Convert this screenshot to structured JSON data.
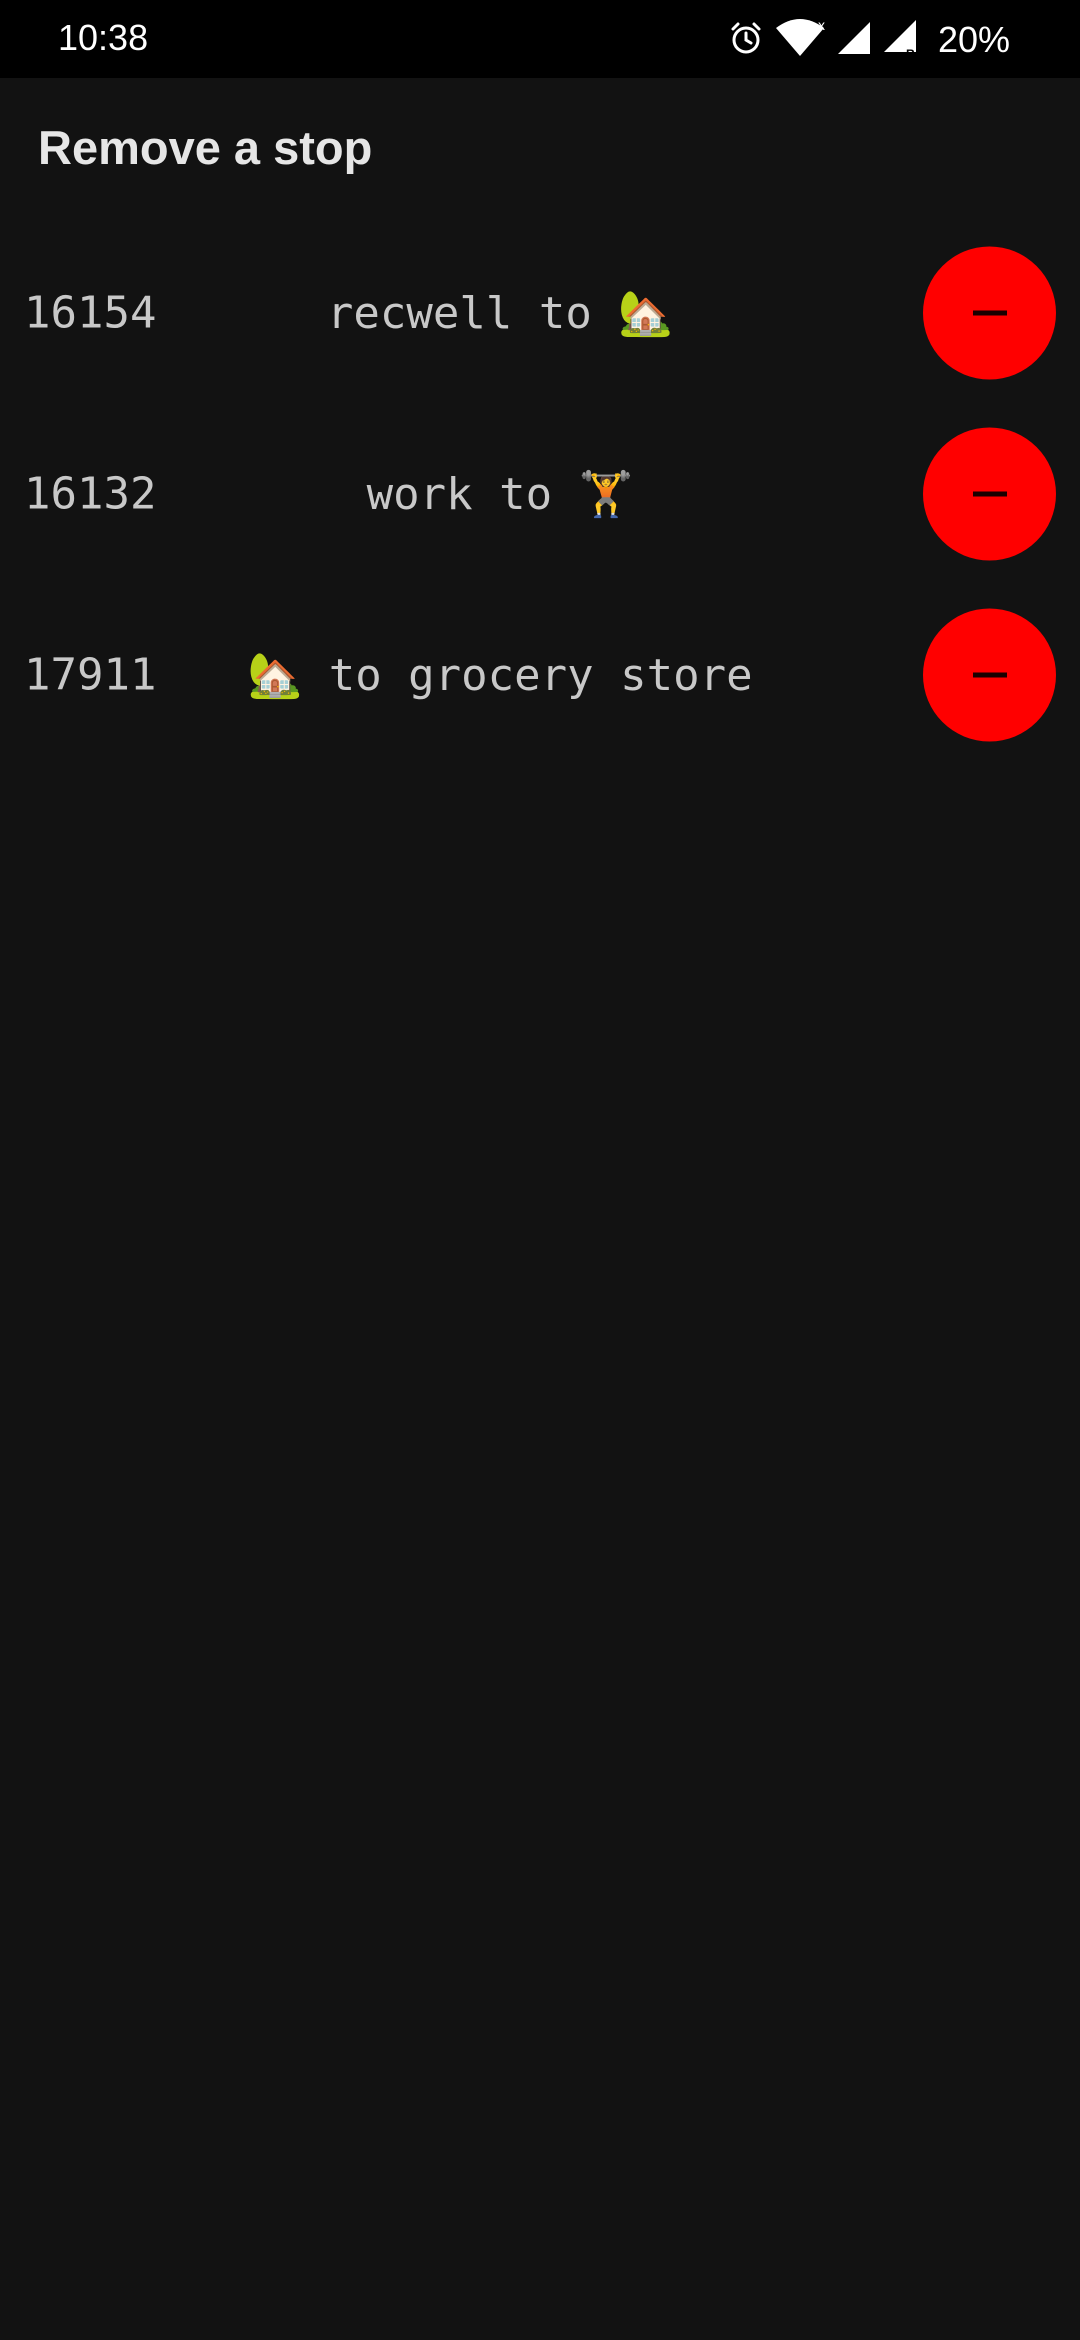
{
  "status_bar": {
    "time": "10:38",
    "battery": "20%",
    "icons": [
      "alarm-icon",
      "wifi-icon",
      "cell-signal-icon",
      "cell-signal-roaming-icon"
    ]
  },
  "header": {
    "title": "Remove a stop"
  },
  "stops": [
    {
      "id": "16154",
      "description": "recwell to 🏡"
    },
    {
      "id": "16132",
      "description": "work to 🏋️"
    },
    {
      "id": "17911",
      "description": "🏡 to grocery store"
    }
  ],
  "colors": {
    "background": "#121212",
    "status_bar": "#000000",
    "remove_button": "#ff0000",
    "text": "#c8c8c8",
    "title": "#e6e6e6"
  },
  "icons": {
    "remove": "minus-icon"
  }
}
